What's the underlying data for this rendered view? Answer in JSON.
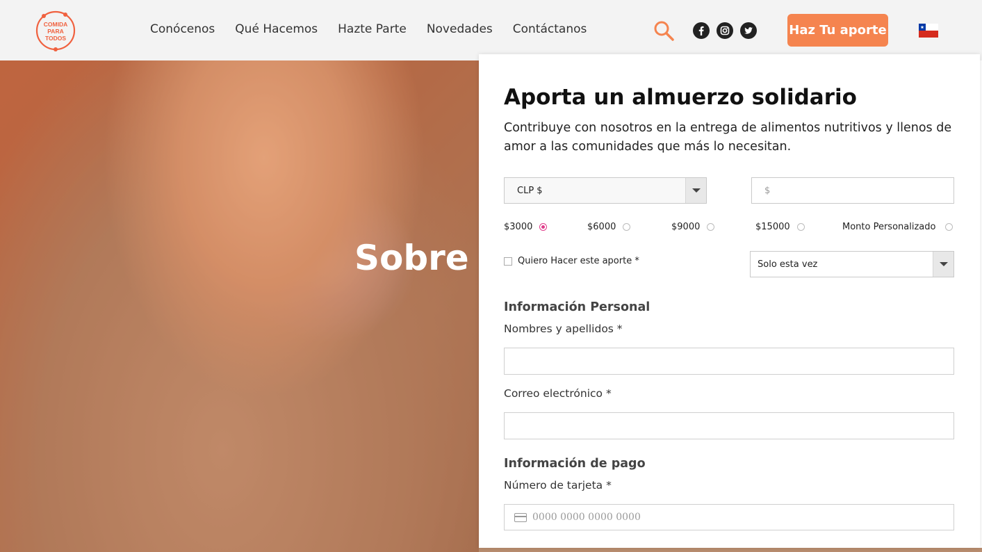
{
  "header": {
    "logo_text": "COMIDA PARA TODOS",
    "nav": [
      "Conócenos",
      "Qué Hacemos",
      "Hazte Parte",
      "Novedades",
      "Contáctanos"
    ],
    "icons": [
      "search-icon",
      "facebook-icon",
      "instagram-icon",
      "twitter-icon"
    ],
    "cta_label": "Haz Tu aporte",
    "flag": "chile-flag-icon"
  },
  "hero": {
    "title": "Sobre"
  },
  "form": {
    "title": "Aporta un almuerzo solidario",
    "description": "Contribuye con nosotros en la entrega de alimentos nutritivos y llenos de amor a las comunidades que más lo necesitan.",
    "currency_select": "CLP $",
    "amount_placeholder": "$",
    "amount_options": [
      {
        "label": "$3000",
        "checked": true
      },
      {
        "label": "$6000",
        "checked": false
      },
      {
        "label": "$9000",
        "checked": false
      },
      {
        "label": "$15000",
        "checked": false
      },
      {
        "label": "Monto Personalizado",
        "checked": false
      }
    ],
    "recurring_checkbox_label": "Quiero Hacer este aporte *",
    "frequency_select": "Solo esta vez",
    "personal_section": "Información Personal",
    "name_label": "Nombres y apellidos *",
    "email_label": "Correo electrónico *",
    "payment_section": "Información de pago",
    "card_label": "Número de tarjeta *",
    "card_placeholder": "0000 0000 0000 0000"
  },
  "colors": {
    "accent": "#f5844f",
    "radio_checked": "#e03c8a",
    "header_bg": "#f3f3f3"
  }
}
